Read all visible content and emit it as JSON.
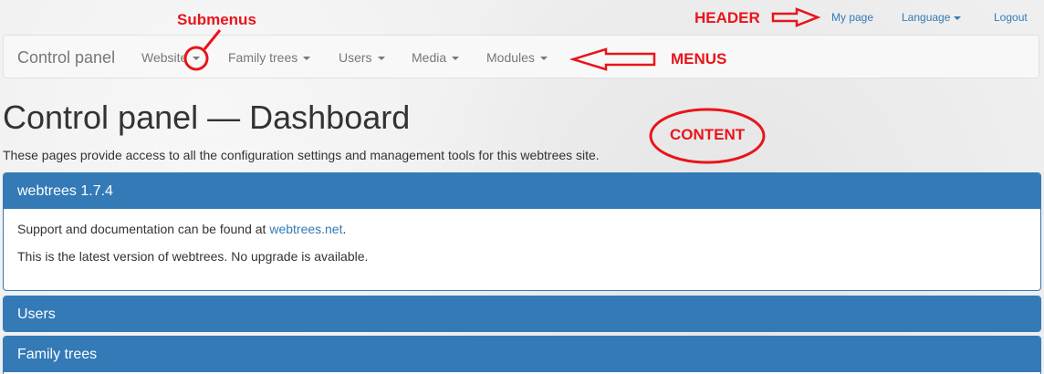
{
  "header": {
    "my_page": "My page",
    "language": "Language",
    "logout": "Logout"
  },
  "navbar": {
    "brand": "Control panel",
    "items": [
      {
        "label": "Website"
      },
      {
        "label": "Family trees"
      },
      {
        "label": "Users"
      },
      {
        "label": "Media"
      },
      {
        "label": "Modules"
      }
    ]
  },
  "main": {
    "title": "Control panel — Dashboard",
    "intro": "These pages provide access to all the configuration settings and management tools for this webtrees site.",
    "panels": [
      {
        "heading": "webtrees 1.7.4",
        "body": {
          "support_prefix": "Support and documentation can be found at ",
          "support_link": "webtrees.net",
          "support_suffix": ".",
          "status": "This is the latest version of webtrees. No upgrade is available."
        }
      },
      {
        "heading": "Users"
      },
      {
        "heading": "Family trees"
      }
    ]
  },
  "annotations": {
    "submenus": "Submenus",
    "header": "HEADER",
    "menus": "MENUS",
    "content": "CONTENT",
    "color": "#e8151b"
  },
  "colors": {
    "primary": "#337ab7",
    "navbar_bg": "#f8f8f8",
    "nav_text": "#777777"
  }
}
